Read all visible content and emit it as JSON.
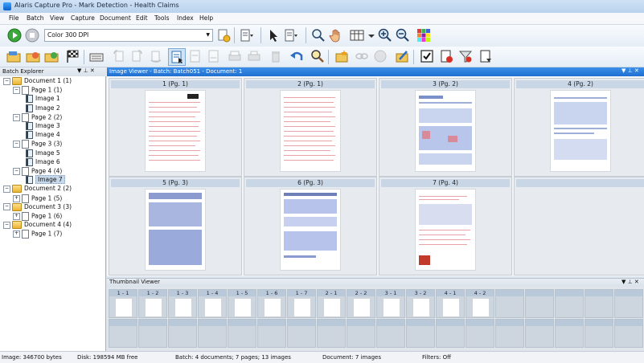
{
  "window": {
    "title": "Alaris Capture Pro - Mark Detection - Health Claims"
  },
  "menu": [
    "File",
    "Batch",
    "View",
    "Capture",
    "Document",
    "Edit",
    "Tools",
    "Index",
    "Help"
  ],
  "toolbar": {
    "profile_value": "Color 300 DPI"
  },
  "explorer": {
    "title": "Batch Explorer",
    "pin": "▼ ⊥ ✕",
    "tree": [
      {
        "label": "Document 1 (1)",
        "kind": "doc",
        "level": 0,
        "selected": false
      },
      {
        "label": "Page 1 (1)",
        "kind": "page",
        "level": 1,
        "selected": false
      },
      {
        "label": "Image 1",
        "kind": "image",
        "level": 2,
        "selected": false
      },
      {
        "label": "Image 2",
        "kind": "image",
        "level": 2,
        "selected": false
      },
      {
        "label": "Page 2 (2)",
        "kind": "page",
        "level": 1,
        "selected": false
      },
      {
        "label": "Image 3",
        "kind": "image",
        "level": 2,
        "selected": false
      },
      {
        "label": "Image 4",
        "kind": "image",
        "level": 2,
        "selected": false
      },
      {
        "label": "Page 3 (3)",
        "kind": "page",
        "level": 1,
        "selected": false
      },
      {
        "label": "Image 5",
        "kind": "image",
        "level": 2,
        "selected": false
      },
      {
        "label": "Image 6",
        "kind": "image",
        "level": 2,
        "selected": false
      },
      {
        "label": "Page 4 (4)",
        "kind": "page",
        "level": 1,
        "selected": false
      },
      {
        "label": "Image 7",
        "kind": "image",
        "level": 2,
        "selected": true
      },
      {
        "label": "Document 2 (2)",
        "kind": "doc",
        "level": 0,
        "selected": false
      },
      {
        "label": "Page 1 (5)",
        "kind": "page",
        "level": 1,
        "selected": false
      },
      {
        "label": "Document 3 (3)",
        "kind": "doc",
        "level": 0,
        "selected": false
      },
      {
        "label": "Page 1 (6)",
        "kind": "page",
        "level": 1,
        "selected": false
      },
      {
        "label": "Document 4 (4)",
        "kind": "doc",
        "level": 0,
        "selected": false
      },
      {
        "label": "Page 1 (7)",
        "kind": "page",
        "level": 1,
        "selected": false
      }
    ]
  },
  "viewer": {
    "title": "Image Viewer - Batch: Batch051 - Document: 1",
    "pin": "▼ ⊥ ✕",
    "cells": [
      "1 (Pg. 1)",
      "2 (Pg. 1)",
      "3 (Pg. 2)",
      "4 (Pg. 2)",
      "5 (Pg. 3)",
      "6 (Pg. 3)",
      "7 (Pg. 4)",
      ""
    ]
  },
  "thumbnails": {
    "title": "Thumbnail Viewer",
    "pin": "▼ ⊥ ✕",
    "labels": [
      "1 - 1",
      "1 - 2",
      "1 - 3",
      "1 - 4",
      "1 - 5",
      "1 - 6",
      "1 - 7",
      "2 - 1",
      "2 - 2",
      "3 - 1",
      "3 - 2",
      "4 - 1",
      "4 - 2",
      "",
      "",
      "",
      "",
      ""
    ]
  },
  "status": {
    "image": "Image: 346700 bytes",
    "disk": "Disk: 198594 MB free",
    "batch": "Batch: 4 documents; 7 pages; 13 images",
    "document": "Document: 7 images",
    "filters": "Filters: Off"
  }
}
